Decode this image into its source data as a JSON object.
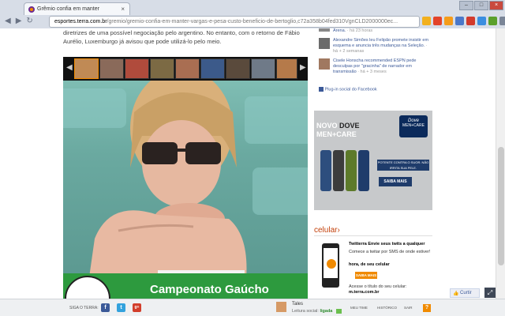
{
  "browser": {
    "tab_title": "Grêmio confia em manter",
    "tab_close": "×",
    "url_host": "esportes.terra.com.br",
    "url_path": "/gremio/gremio-confia-em-manter-vargas-e-pesa-custo-beneficio-de-bertoglio,c72a358b04fed310VgnCLD2000000ec...",
    "nav_back": "◀",
    "nav_forward": "▶",
    "nav_reload": "↻",
    "window_minimize": "–",
    "window_maximize": "□",
    "window_close": "×"
  },
  "article": {
    "text_line1": "diretrizes de uma possível negociação pelo argentino. No entanto, com o retorno de Fábio",
    "text_line2": "Aurélio, Luxemburgo já avisou que pode utilizá-lo pelo meio.",
    "gallery_prev": "◀",
    "gallery_next": "▶"
  },
  "banner": {
    "title": "Campeonato Gaúcho"
  },
  "sidebar": {
    "feed": [
      {
        "text": "Arena.",
        "meta": "· há 23 horas"
      },
      {
        "text": "Alexandre Simões leu Felipão promete insistir em esquema e anuncia três mudanças na Seleção.",
        "meta": "· há + 2 semanas"
      },
      {
        "text": "Cisele Honscha recommended ESPN pede desculpas por \"gracinha\" de narrador em transmissão",
        "meta": "· há + 3 meses"
      }
    ],
    "fb_plugin": "Plug-in social do Facebook",
    "ad": {
      "novo": "NOVO",
      "dove": "DOVE",
      "mencare": "MEN+CARE",
      "logo_line1": "Dove",
      "logo_line2": "MEN+CARE",
      "tagline": "POTENTE CONTRA O SUOR. NÃO IRRITA SUA PELE.",
      "cta": "SAIBA MAIS"
    },
    "celular": {
      "heading": "celular",
      "chev": "›",
      "line1": "Twitterra Envie seus twits a qualquer",
      "line2": "Comece a twitar por SMS de onde estiver!",
      "line3": "hora, de seu celular",
      "cta": "SAIBA MAIS",
      "line4": "Acesse o título do seu celular:",
      "line5": "m.terra.com.br"
    }
  },
  "bottombar": {
    "siga": "SIGA O TERRA:",
    "facebook": "f",
    "twitter": "t",
    "googleplus": "g+",
    "user_name": "Tales",
    "leitura_label": "Leitura social:",
    "leitura_state": "ligada",
    "meu_time": "MEU TIME",
    "historico": "HISTÓRICO",
    "sair": "SAIR",
    "help": "?"
  },
  "like": {
    "label": "Curtir"
  },
  "colors": {
    "terra_orange": "#f08a00",
    "banner_green": "#2d9a3e",
    "facebook_blue": "#3b5998"
  }
}
